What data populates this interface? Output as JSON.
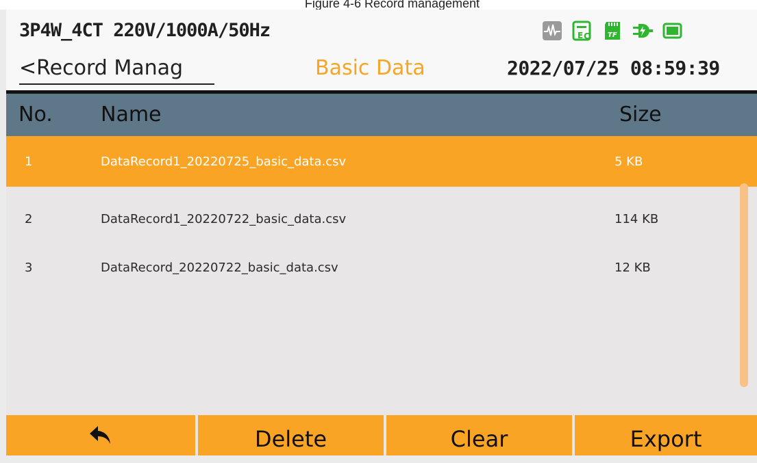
{
  "caption": "Figure 4-6 Record management",
  "header": {
    "config": "3P4W_4CT 220V/1000A/50Hz",
    "datetime": "2022/07/25 08:59:39",
    "back_label": "<Record Manag",
    "title": "Basic Data",
    "status_icons": [
      "waveform-icon",
      "ec-record-icon",
      "tf-card-icon",
      "plug-icon",
      "battery-icon"
    ]
  },
  "table": {
    "headers": {
      "no": "No.",
      "name": "Name",
      "size": "Size"
    },
    "rows": [
      {
        "no": "1",
        "name": "DataRecord1_20220725_basic_data.csv",
        "size": "5 KB",
        "selected": true
      },
      {
        "no": "2",
        "name": "DataRecord1_20220722_basic_data.csv",
        "size": "114 KB",
        "selected": false
      },
      {
        "no": "3",
        "name": "DataRecord_20220722_basic_data.csv",
        "size": "12 KB",
        "selected": false
      }
    ]
  },
  "footer": {
    "back_icon": "return-arrow-icon",
    "delete": "Delete",
    "clear": "Clear",
    "export": "Export"
  },
  "colors": {
    "accent": "#f9a424",
    "header_bg": "#5f7889",
    "status_green": "#2fb52f",
    "status_gray": "#9a9a9a"
  }
}
